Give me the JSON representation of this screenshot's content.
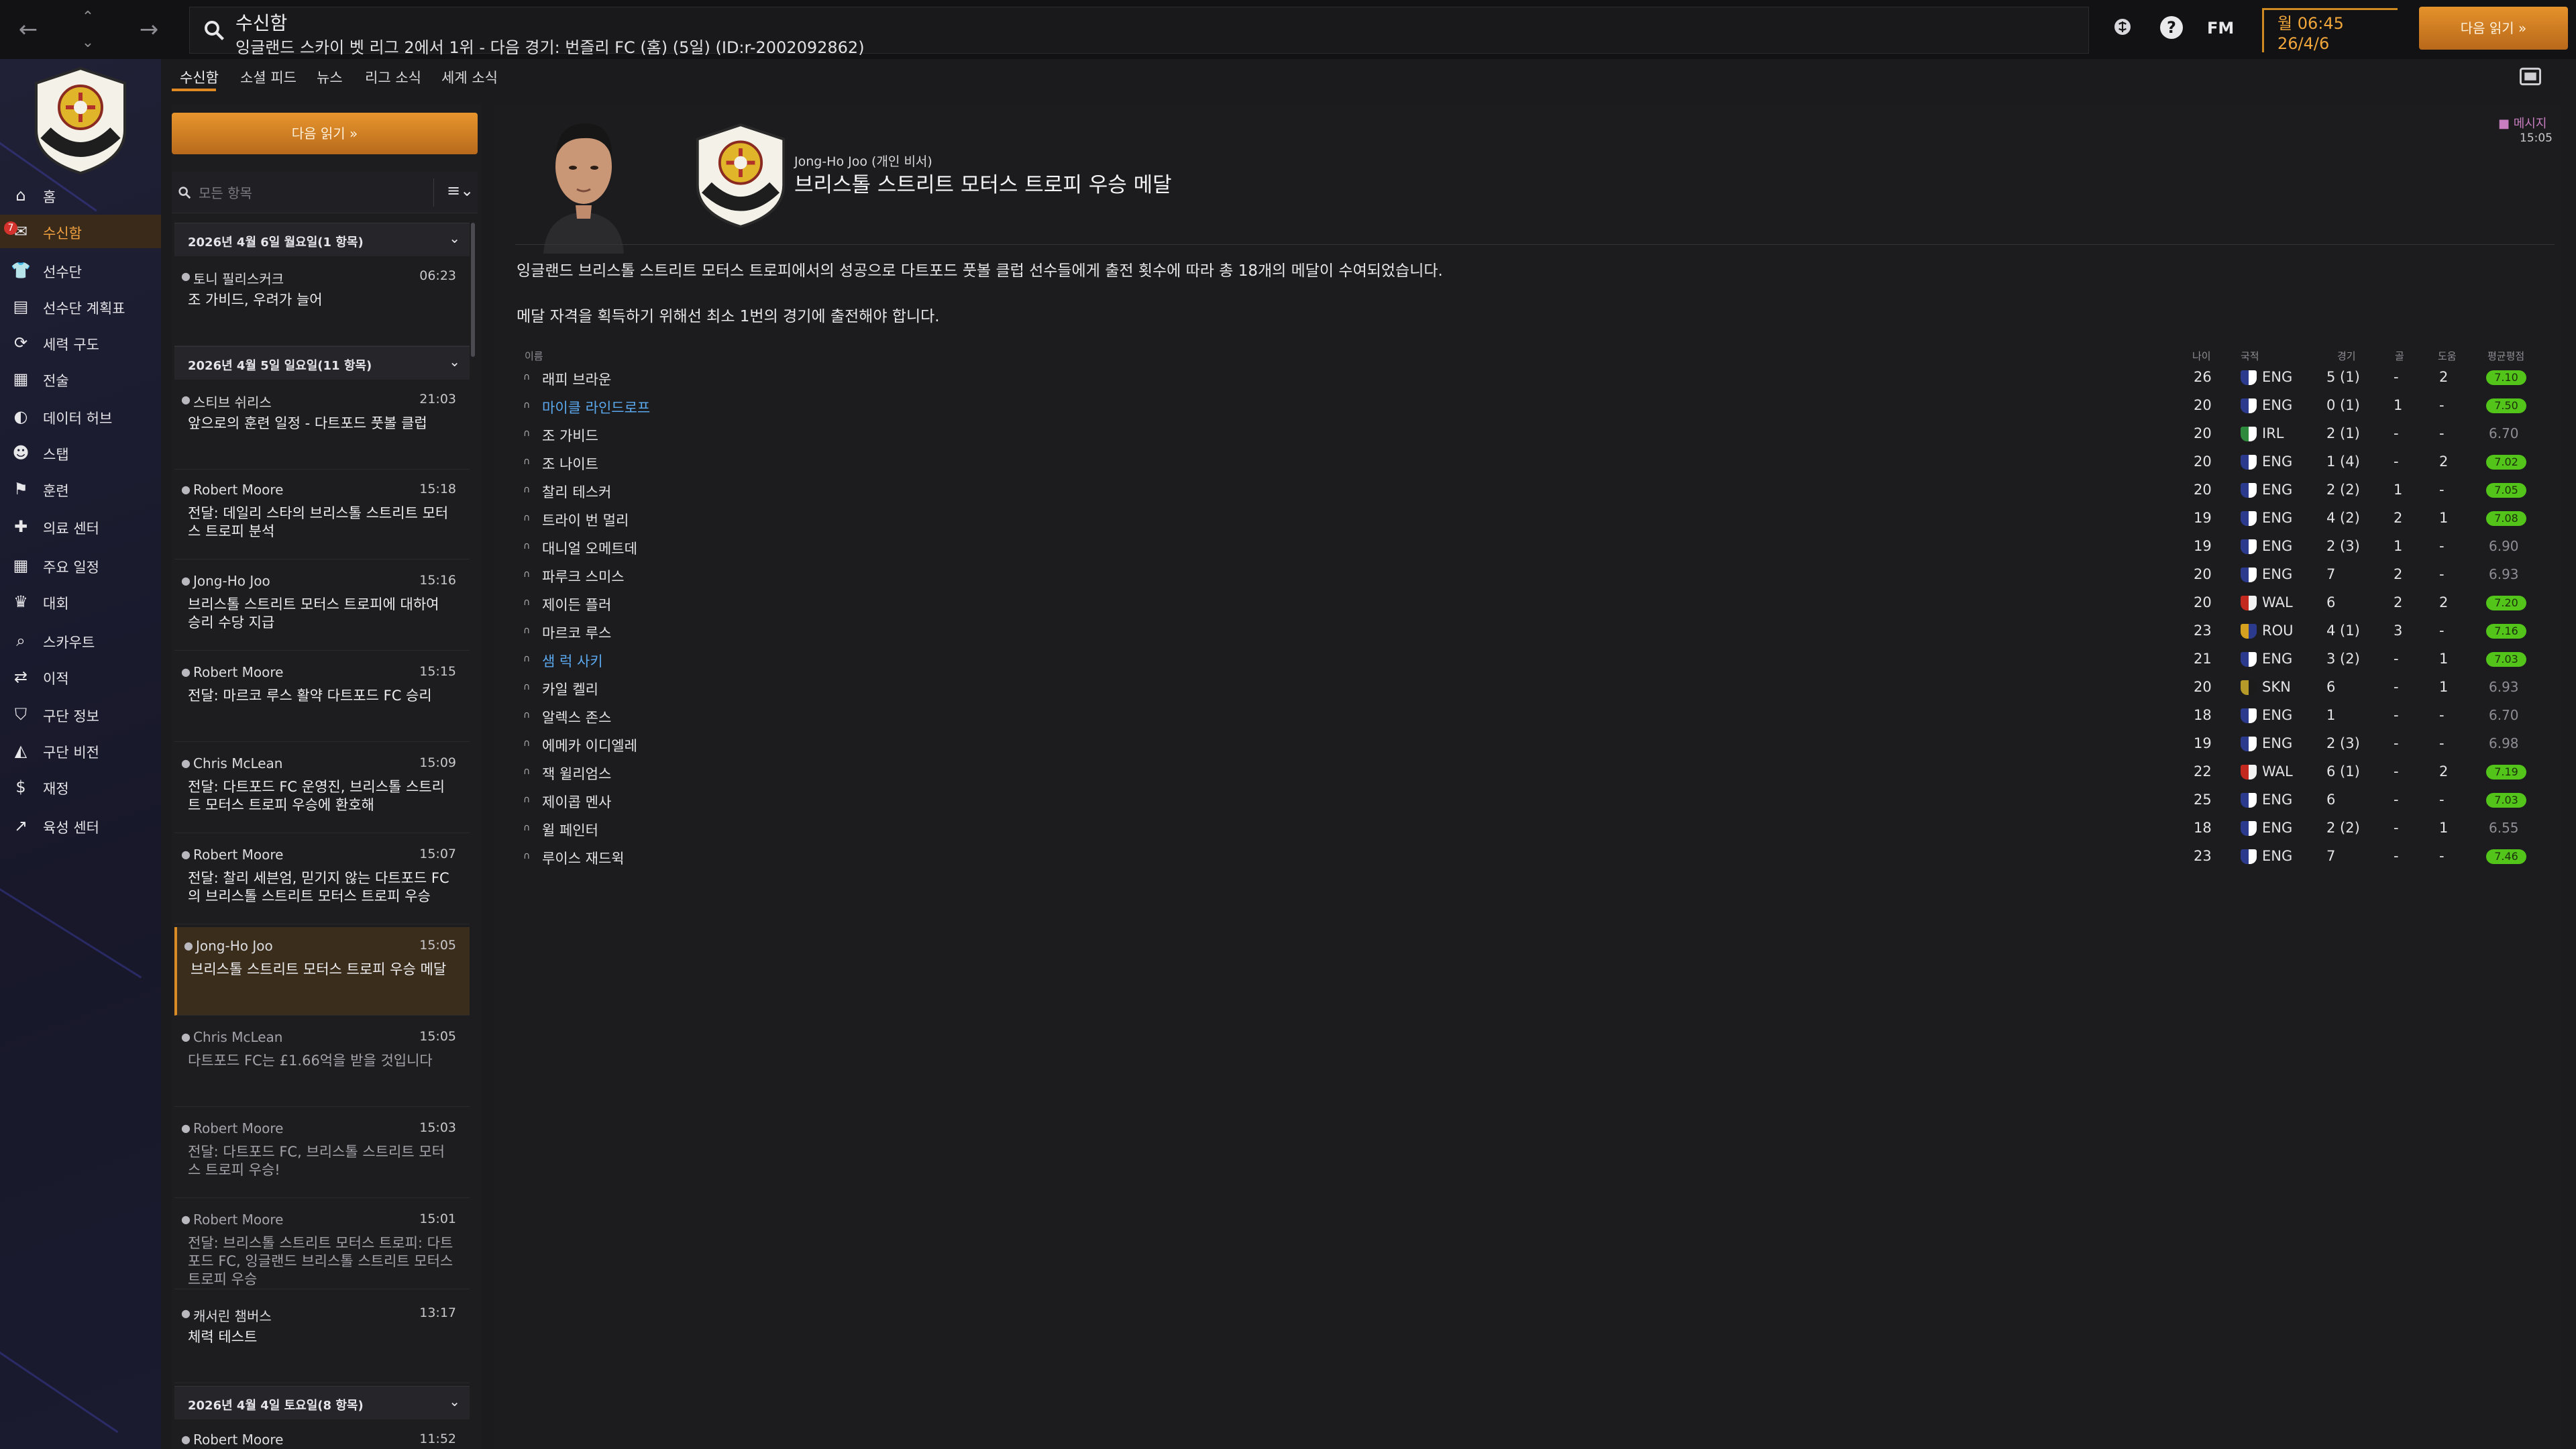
{
  "header": {
    "title": "수신함",
    "subtitle": "잉글랜드 스카이 벳 리그 2에서 1위 - 다음 경기: 번즐리 FC (홈) (5일) (ID:r-2002092862)",
    "time": "월 06:45",
    "date": "26/4/6",
    "fm_label": "FM",
    "continue_label": "다음 읽기"
  },
  "sidebar": {
    "badge": "7",
    "items": [
      {
        "label": "홈",
        "icon": "home-icon"
      },
      {
        "label": "수신함",
        "icon": "inbox-icon"
      },
      {
        "label": "선수단",
        "icon": "squad-icon"
      },
      {
        "label": "선수단 계획표",
        "icon": "planner-icon"
      },
      {
        "label": "세력 구도",
        "icon": "dynamics-icon"
      },
      {
        "label": "전술",
        "icon": "tactics-icon"
      },
      {
        "label": "데이터 허브",
        "icon": "data-hub-icon"
      },
      {
        "label": "스탭",
        "icon": "staff-icon"
      },
      {
        "label": "훈련",
        "icon": "training-icon"
      },
      {
        "label": "의료 센터",
        "icon": "medical-icon"
      },
      {
        "label": "주요 일정",
        "icon": "calendar-icon"
      },
      {
        "label": "대회",
        "icon": "trophy-icon"
      },
      {
        "label": "스카우트",
        "icon": "scouting-icon"
      },
      {
        "label": "이적",
        "icon": "transfers-icon"
      },
      {
        "label": "구단 정보",
        "icon": "club-info-icon"
      },
      {
        "label": "구단 비전",
        "icon": "club-vision-icon"
      },
      {
        "label": "재정",
        "icon": "finances-icon"
      },
      {
        "label": "육성 센터",
        "icon": "development-icon"
      }
    ]
  },
  "tabs": [
    "수신함",
    "소셜 피드",
    "뉴스",
    "리그 소식",
    "세계 소식"
  ],
  "inbox": {
    "continue_label": "다음 읽기",
    "filter_placeholder": "모든 항목",
    "groups": [
      {
        "header": "2026년 4월 6일 월요일(1 항목)"
      },
      {
        "header": "2026년 4월 5일 일요일(11 항목)"
      },
      {
        "header": "2026년 4월 4일 토요일(8 항목)"
      }
    ],
    "messages": [
      {
        "sender": "토니 필리스커크",
        "time": "06:23",
        "subject": "조 가비드, 우려가 늘어"
      },
      {
        "sender": "스티브 쉬리스",
        "time": "21:03",
        "subject": "앞으로의 훈련 일정 - 다트포드 풋볼 클럽"
      },
      {
        "sender": "Robert Moore",
        "time": "15:18",
        "subject": "전달: 데일리 스타의 브리스톨 스트리트 모터스 트로피 분석"
      },
      {
        "sender": "Jong-Ho Joo",
        "time": "15:16",
        "subject": "브리스톨 스트리트 모터스 트로피에 대하여 승리 수당 지급"
      },
      {
        "sender": "Robert Moore",
        "time": "15:15",
        "subject": "전달: 마르코 루스 활약 다트포드 FC 승리"
      },
      {
        "sender": "Chris McLean",
        "time": "15:09",
        "subject": "전달: 다트포드 FC 운영진, 브리스톨 스트리트 모터스 트로피 우승에 환호해"
      },
      {
        "sender": "Robert Moore",
        "time": "15:07",
        "subject": "전달: 찰리 세븐엄, 믿기지 않는 다트포드 FC의 브리스톨 스트리트 모터스 트로피 우승"
      },
      {
        "sender": "Jong-Ho Joo",
        "time": "15:05",
        "subject": "브리스톨 스트리트 모터스 트로피 우승 메달"
      },
      {
        "sender": "Chris McLean",
        "time": "15:05",
        "subject": "다트포드 FC는 £1.66억을 받을 것입니다"
      },
      {
        "sender": "Robert Moore",
        "time": "15:03",
        "subject": "전달: 다트포드 FC, 브리스톨 스트리트 모터스 트로피 우승!"
      },
      {
        "sender": "Robert Moore",
        "time": "15:01",
        "subject": "전달: 브리스톨 스트리트 모터스 트로피: 다트포드 FC, 잉글랜드 브리스톨 스트리트 모터스 트로피 우승"
      },
      {
        "sender": "캐서린 챔버스",
        "time": "13:17",
        "subject": "체력 테스트"
      },
      {
        "sender": "Robert Moore",
        "time": "11:52",
        "subject": ""
      }
    ]
  },
  "message": {
    "from": "Jong-Ho Joo (개인 비서)",
    "title": "브리스톨 스트리트 모터스 트로피 우승 메달",
    "tag": "메시지",
    "time": "15:05",
    "body1": "잉글랜드 브리스톨 스트리트 모터스 트로피에서의 성공으로 다트포드 풋볼 클럽 선수들에게 출전 횟수에 따라 총 18개의 메달이 수여되었습니다.",
    "body2": "메달 자격을 획득하기 위해선 최소 1번의 경기에 출전해야 합니다."
  },
  "table": {
    "headers": {
      "name": "이름",
      "age": "나이",
      "nat": "국적",
      "apps": "경기",
      "goals": "골",
      "assists": "도움",
      "rating": "평균평점"
    },
    "rows": [
      {
        "name": "래피 브라운",
        "link": false,
        "age": "26",
        "nat": "ENG",
        "apps": "5 (1)",
        "goals": "-",
        "assists": "2",
        "rating": "7.10",
        "pill": true
      },
      {
        "name": "마이클 라인드로프",
        "link": true,
        "age": "20",
        "nat": "ENG",
        "apps": "0 (1)",
        "goals": "1",
        "assists": "-",
        "rating": "7.50",
        "pill": true
      },
      {
        "name": "조 가비드",
        "link": false,
        "age": "20",
        "nat": "IRL",
        "apps": "2 (1)",
        "goals": "-",
        "assists": "-",
        "rating": "6.70",
        "pill": false
      },
      {
        "name": "조 나이트",
        "link": false,
        "age": "20",
        "nat": "ENG",
        "apps": "1 (4)",
        "goals": "-",
        "assists": "2",
        "rating": "7.02",
        "pill": true
      },
      {
        "name": "찰리 테스커",
        "link": false,
        "age": "20",
        "nat": "ENG",
        "apps": "2 (2)",
        "goals": "1",
        "assists": "-",
        "rating": "7.05",
        "pill": true
      },
      {
        "name": "트라이 번 멀리",
        "link": false,
        "age": "19",
        "nat": "ENG",
        "apps": "4 (2)",
        "goals": "2",
        "assists": "1",
        "rating": "7.08",
        "pill": true
      },
      {
        "name": "대니얼 오메트데",
        "link": false,
        "age": "19",
        "nat": "ENG",
        "apps": "2 (3)",
        "goals": "1",
        "assists": "-",
        "rating": "6.90",
        "pill": false
      },
      {
        "name": "파루크 스미스",
        "link": false,
        "age": "20",
        "nat": "ENG",
        "apps": "7",
        "goals": "2",
        "assists": "-",
        "rating": "6.93",
        "pill": false
      },
      {
        "name": "제이든 플러",
        "link": false,
        "age": "20",
        "nat": "WAL",
        "apps": "6",
        "goals": "2",
        "assists": "2",
        "rating": "7.20",
        "pill": true
      },
      {
        "name": "마르코 루스",
        "link": false,
        "age": "23",
        "nat": "ROU",
        "apps": "4 (1)",
        "goals": "3",
        "assists": "-",
        "rating": "7.16",
        "pill": true
      },
      {
        "name": "샘 럭 사키",
        "link": true,
        "age": "21",
        "nat": "ENG",
        "apps": "3 (2)",
        "goals": "-",
        "assists": "1",
        "rating": "7.03",
        "pill": true
      },
      {
        "name": "카일 켈리",
        "link": false,
        "age": "20",
        "nat": "SKN",
        "apps": "6",
        "goals": "-",
        "assists": "1",
        "rating": "6.93",
        "pill": false
      },
      {
        "name": "알렉스 존스",
        "link": false,
        "age": "18",
        "nat": "ENG",
        "apps": "1",
        "goals": "-",
        "assists": "-",
        "rating": "6.70",
        "pill": false
      },
      {
        "name": "에메카 이디엘레",
        "link": false,
        "age": "19",
        "nat": "ENG",
        "apps": "2 (3)",
        "goals": "-",
        "assists": "-",
        "rating": "6.98",
        "pill": false
      },
      {
        "name": "잭 윌리엄스",
        "link": false,
        "age": "22",
        "nat": "WAL",
        "apps": "6 (1)",
        "goals": "-",
        "assists": "2",
        "rating": "7.19",
        "pill": true
      },
      {
        "name": "제이콥 멘사",
        "link": false,
        "age": "25",
        "nat": "ENG",
        "apps": "6",
        "goals": "-",
        "assists": "-",
        "rating": "7.03",
        "pill": true
      },
      {
        "name": "윌 페인터",
        "link": false,
        "age": "18",
        "nat": "ENG",
        "apps": "2 (2)",
        "goals": "-",
        "assists": "1",
        "rating": "6.55",
        "pill": false
      },
      {
        "name": "루이스 재드윅",
        "link": false,
        "age": "23",
        "nat": "ENG",
        "apps": "7",
        "goals": "-",
        "assists": "-",
        "rating": "7.46",
        "pill": true
      }
    ]
  },
  "colors": {
    "accent": "#e08a24",
    "link": "#5ba9ef",
    "rating_green": "#52c41a"
  }
}
